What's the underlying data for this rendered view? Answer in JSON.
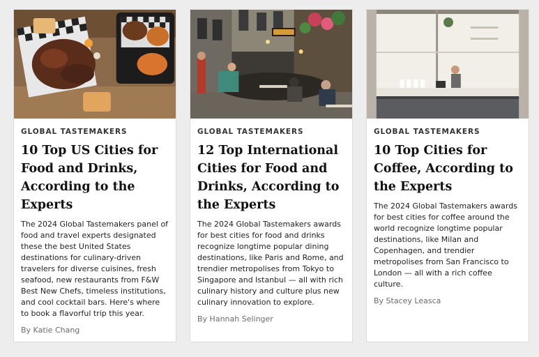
{
  "cards": [
    {
      "kicker": "GLOBAL TASTEMAKERS",
      "title": "10 Top US Cities for Food and Drinks, According to the Experts",
      "description": "The 2024 Global Tastemakers panel of food and travel experts designated these the best United States destinations for culinary-driven travelers for diverse cuisines, fresh seafood, new restaurants from F&W Best New Chefs, timeless institutions, and cool cocktail bars. Here's where to book a flavorful trip this year.",
      "byline": "By Katie Chang",
      "image": "bbq-platter-photo"
    },
    {
      "kicker": "GLOBAL TASTEMAKERS",
      "title": "12 Top International Cities for Food and Drinks, According to the Experts",
      "description": "The 2024 Global Tastemakers awards for best cities for food and drinks recognize longtime popular dining destinations, like Paris and Rome, and trendier metropolises from Tokyo to Singapore and Istanbul — all with rich culinary history and culture plus new culinary innovation to explore.",
      "byline": "By Hannah Selinger",
      "image": "street-dining-photo"
    },
    {
      "kicker": "GLOBAL TASTEMAKERS",
      "title": "10 Top Cities for Coffee, According to the Experts",
      "description": "The 2024 Global Tastemakers awards for best cities for coffee around the world recognize longtime popular destinations, like Milan and Copenhagen, and trendier metropolises from San Francisco to London — all with a rich coffee culture.",
      "byline": "By Stacey Leasca",
      "image": "coffee-shop-photo"
    }
  ],
  "colors": {
    "background": "#ededed",
    "card": "#ffffff",
    "byline": "#6b6b6b"
  }
}
